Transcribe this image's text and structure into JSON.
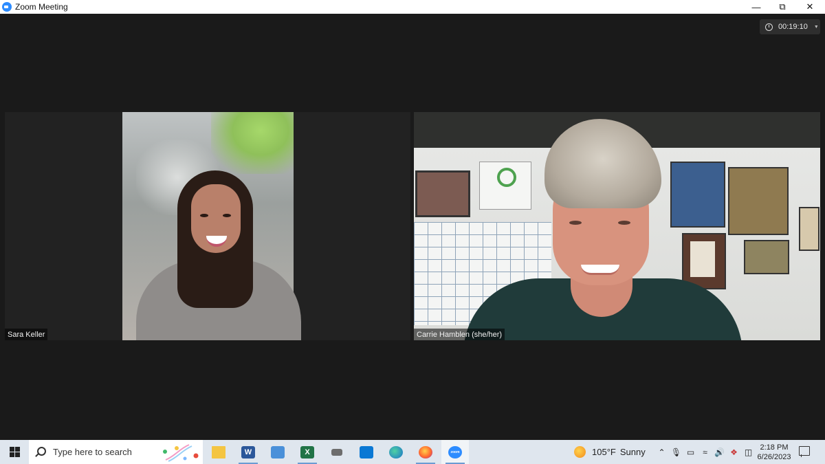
{
  "window": {
    "title": "Zoom Meeting",
    "minimize_icon": "minimize-icon",
    "restore_icon": "restore-icon",
    "close_icon": "close-icon"
  },
  "meeting": {
    "timer": "00:19:10",
    "participants": [
      {
        "name": "Sara Keller"
      },
      {
        "name": "Carrie Hamblen (she/her)"
      }
    ]
  },
  "taskbar": {
    "search_placeholder": "Type here to search",
    "apps": [
      {
        "icon": "file-explorer-icon",
        "active": false
      },
      {
        "icon": "word-icon",
        "active": false,
        "glyph": "W"
      },
      {
        "icon": "remote-desktop-icon",
        "active": false
      },
      {
        "icon": "excel-icon",
        "active": false,
        "glyph": "X"
      },
      {
        "icon": "snipping-tool-icon",
        "active": false
      },
      {
        "icon": "outlook-icon",
        "active": false
      },
      {
        "icon": "edge-icon",
        "active": false
      },
      {
        "icon": "firefox-icon",
        "active": false
      },
      {
        "icon": "zoom-icon",
        "active": true,
        "glyph": "zoom"
      }
    ],
    "weather": {
      "temp": "105°F",
      "condition": "Sunny"
    },
    "time": "2:18 PM",
    "date": "6/26/2023"
  },
  "colors": {
    "meeting_bg": "#1a1a1a",
    "tile_bg": "#222222",
    "taskbar_bg": "#dfe6ee",
    "zoom_blue": "#2d8cff"
  }
}
